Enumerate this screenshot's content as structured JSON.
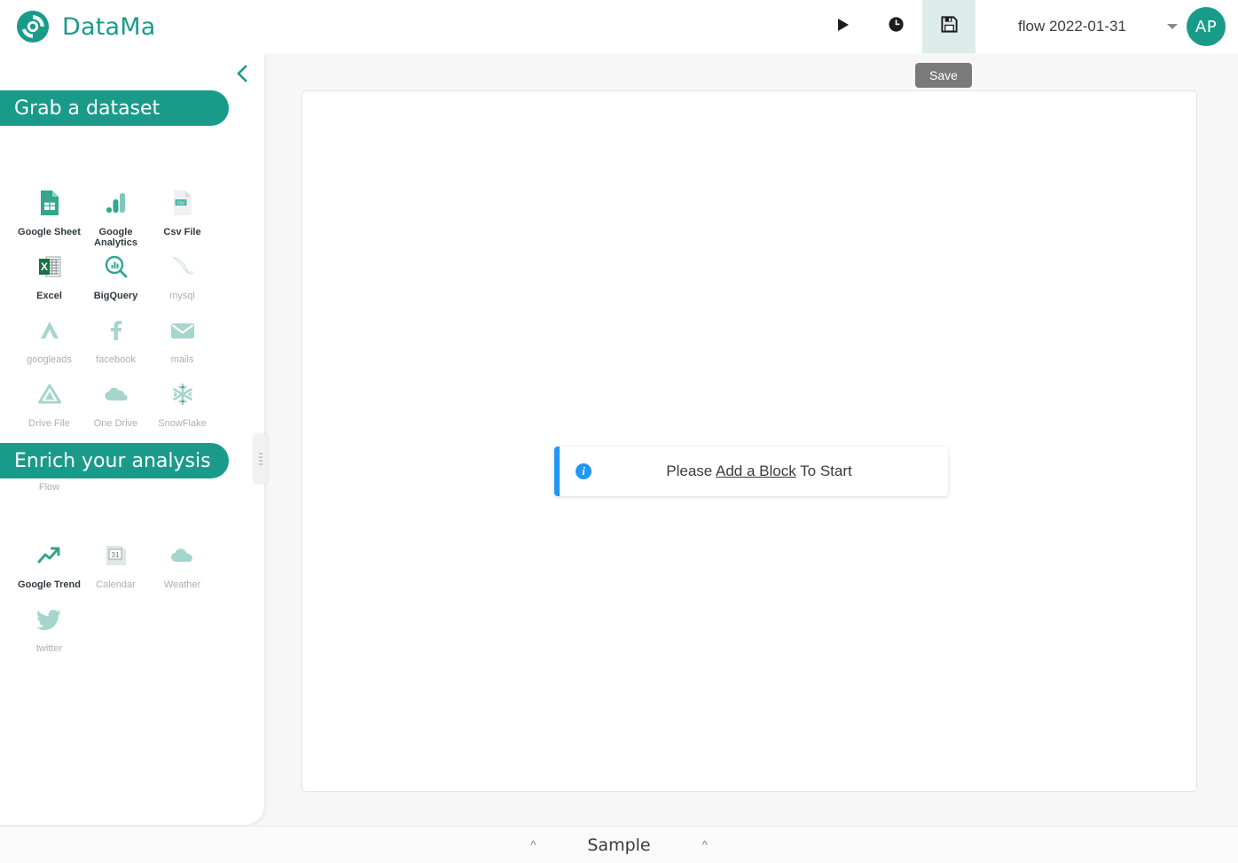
{
  "app": {
    "brand_name": "DataMa",
    "logo_icon": "datama-disc-icon"
  },
  "toolbar": {
    "run_icon": "play-icon",
    "history_icon": "clock-icon",
    "save_icon": "floppy-save-icon",
    "save_tooltip": "Save",
    "flow_selected": "flow 2022-01-31",
    "dropdown_icon": "chevron-down-icon",
    "avatar_initials": "AP"
  },
  "sidebar": {
    "collapse_icon": "chevron-left-icon",
    "resize_handle_icon": "drag-grip-icon",
    "sections": [
      {
        "title": "Grab a dataset",
        "items": [
          {
            "label": "Google Sheet",
            "icon": "google-sheet-icon",
            "muted": false
          },
          {
            "label": "Google Analytics",
            "icon": "google-analytics-icon",
            "muted": false
          },
          {
            "label": "Csv File",
            "icon": "csv-file-icon",
            "muted": false
          },
          {
            "label": "Excel",
            "icon": "excel-icon",
            "muted": false
          },
          {
            "label": "BigQuery",
            "icon": "bigquery-icon",
            "muted": false
          },
          {
            "label": "mysql",
            "icon": "mysql-dolphin-icon",
            "muted": true
          },
          {
            "label": "googleads",
            "icon": "google-ads-icon",
            "muted": true
          },
          {
            "label": "facebook",
            "icon": "facebook-icon",
            "muted": true
          },
          {
            "label": "mails",
            "icon": "mail-envelope-icon",
            "muted": true
          },
          {
            "label": "Drive File",
            "icon": "google-drive-icon",
            "muted": true
          },
          {
            "label": "One Drive",
            "icon": "onedrive-cloud-icon",
            "muted": true
          },
          {
            "label": "SnowFlake",
            "icon": "snowflake-icon",
            "muted": true
          },
          {
            "label": "Flow",
            "icon": "flow-sitemap-icon",
            "muted": true
          }
        ]
      },
      {
        "title": "Enrich your analysis",
        "items": [
          {
            "label": "Google Trend",
            "icon": "trending-up-icon",
            "muted": false
          },
          {
            "label": "Calendar",
            "icon": "calendar-31-icon",
            "muted": true
          },
          {
            "label": "Weather",
            "icon": "weather-cloud-icon",
            "muted": true
          },
          {
            "label": "twitter",
            "icon": "twitter-bird-icon",
            "muted": true
          }
        ]
      }
    ]
  },
  "main": {
    "alert": {
      "icon": "info-circle-icon",
      "prefix": "Please ",
      "link": "Add a Block",
      "suffix": " To Start"
    }
  },
  "bottombar": {
    "left_chevron_icon": "chevron-up-icon",
    "label": "Sample",
    "right_chevron_icon": "chevron-up-icon"
  },
  "colors": {
    "brand_teal": "#1a9b8a",
    "muted_teal": "#a5d5cd",
    "info_blue": "#2196f3",
    "tooltip_gray": "#7a7a7a",
    "canvas_bg": "#f7f7f7"
  }
}
